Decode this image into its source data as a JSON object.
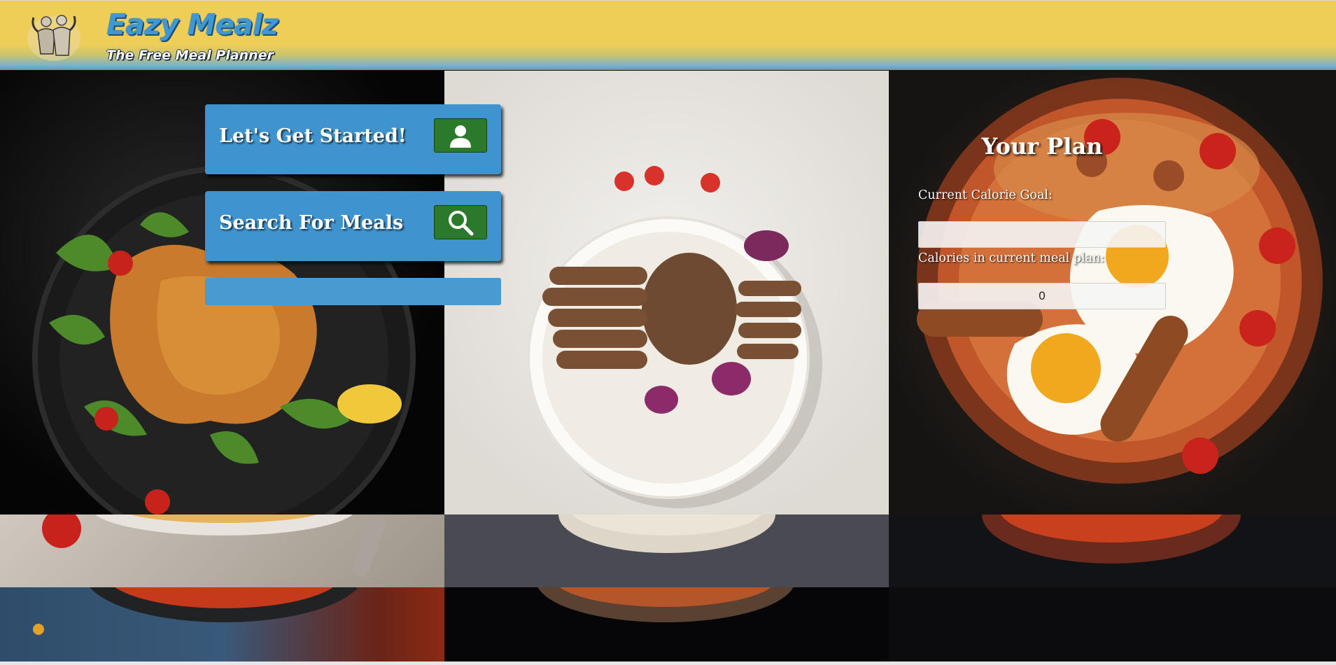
{
  "header": {
    "title": "Eazy Mealz",
    "subtitle": "The Free Meal Planner",
    "logo_icon": "bodybuilders-logo-icon"
  },
  "actions": {
    "get_started_label": "Let's Get Started!",
    "get_started_icon": "user-icon",
    "search_label": "Search For Meals",
    "search_icon": "search-icon"
  },
  "plan": {
    "title": "Your Plan",
    "calorie_goal_label": "Current Calorie Goal:",
    "calorie_goal_value": "",
    "meal_plan_calories_label": "Calories in current meal plan:",
    "meal_plan_calories_value": "0"
  },
  "colors": {
    "header_yellow": "#efce58",
    "brand_blue": "#3f98d4",
    "panel_blue": "#3f94cf",
    "button_green": "#2b7a2b"
  }
}
